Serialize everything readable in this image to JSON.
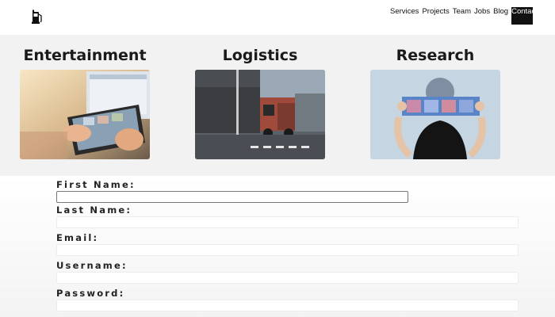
{
  "header": {
    "logo_icon": "fuel-pump-icon",
    "nav": [
      {
        "label": "Services"
      },
      {
        "label": "Projects"
      },
      {
        "label": "Team"
      },
      {
        "label": "Jobs"
      },
      {
        "label": "Blog"
      },
      {
        "label": "Contact",
        "active": true
      }
    ]
  },
  "categories": [
    {
      "title": "Entertainment",
      "image": "person-using-tablet-image"
    },
    {
      "title": "Logistics",
      "image": "truck-at-loading-dock-image"
    },
    {
      "title": "Research",
      "image": "woman-holding-film-strip-image"
    }
  ],
  "form": {
    "fields": [
      {
        "label": "First Name:",
        "value": ""
      },
      {
        "label": "Last Name:",
        "value": ""
      },
      {
        "label": "Email:",
        "value": ""
      },
      {
        "label": "Username:",
        "value": ""
      },
      {
        "label": "Password:",
        "value": ""
      }
    ]
  }
}
